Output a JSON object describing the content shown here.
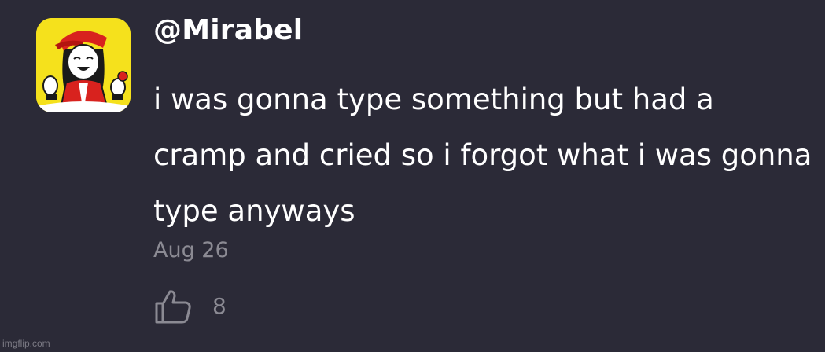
{
  "post": {
    "avatar_icon": "profile-picture-cartoon-girl-red-cap",
    "username": "@Mirabel",
    "text": "i was gonna type something but had a cramp and cried so i forgot what i was gonna type anyways",
    "date": "Aug 26",
    "like_icon": "thumbs-up-icon",
    "like_count": "8"
  },
  "watermark": "imgflip.com",
  "colors": {
    "background": "#2b2a37",
    "text": "#ffffff",
    "muted": "#8b8a93",
    "avatar_bg": "#f5e11c"
  }
}
